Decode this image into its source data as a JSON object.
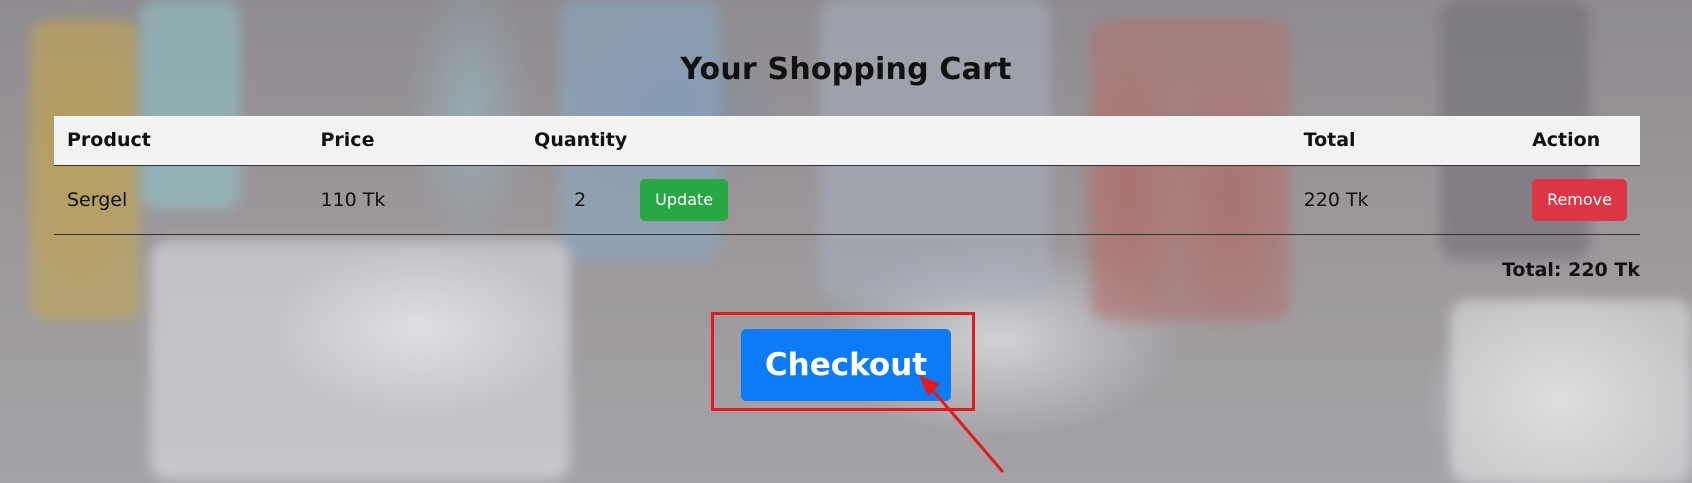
{
  "page": {
    "title": "Your Shopping Cart"
  },
  "cart": {
    "columns": {
      "product": "Product",
      "price": "Price",
      "quantity": "Quantity",
      "total": "Total",
      "action": "Action"
    },
    "items": [
      {
        "product": "Sergel",
        "price": "110 Tk",
        "quantity": "2",
        "update_label": "Update",
        "total": "220 Tk",
        "remove_label": "Remove"
      }
    ],
    "grand_total": "Total: 220 Tk"
  },
  "checkout": {
    "label": "Checkout"
  },
  "colors": {
    "update": "#28a745",
    "remove": "#dc3545",
    "checkout": "#0d7bf7",
    "annotation": "#e01b1b"
  }
}
